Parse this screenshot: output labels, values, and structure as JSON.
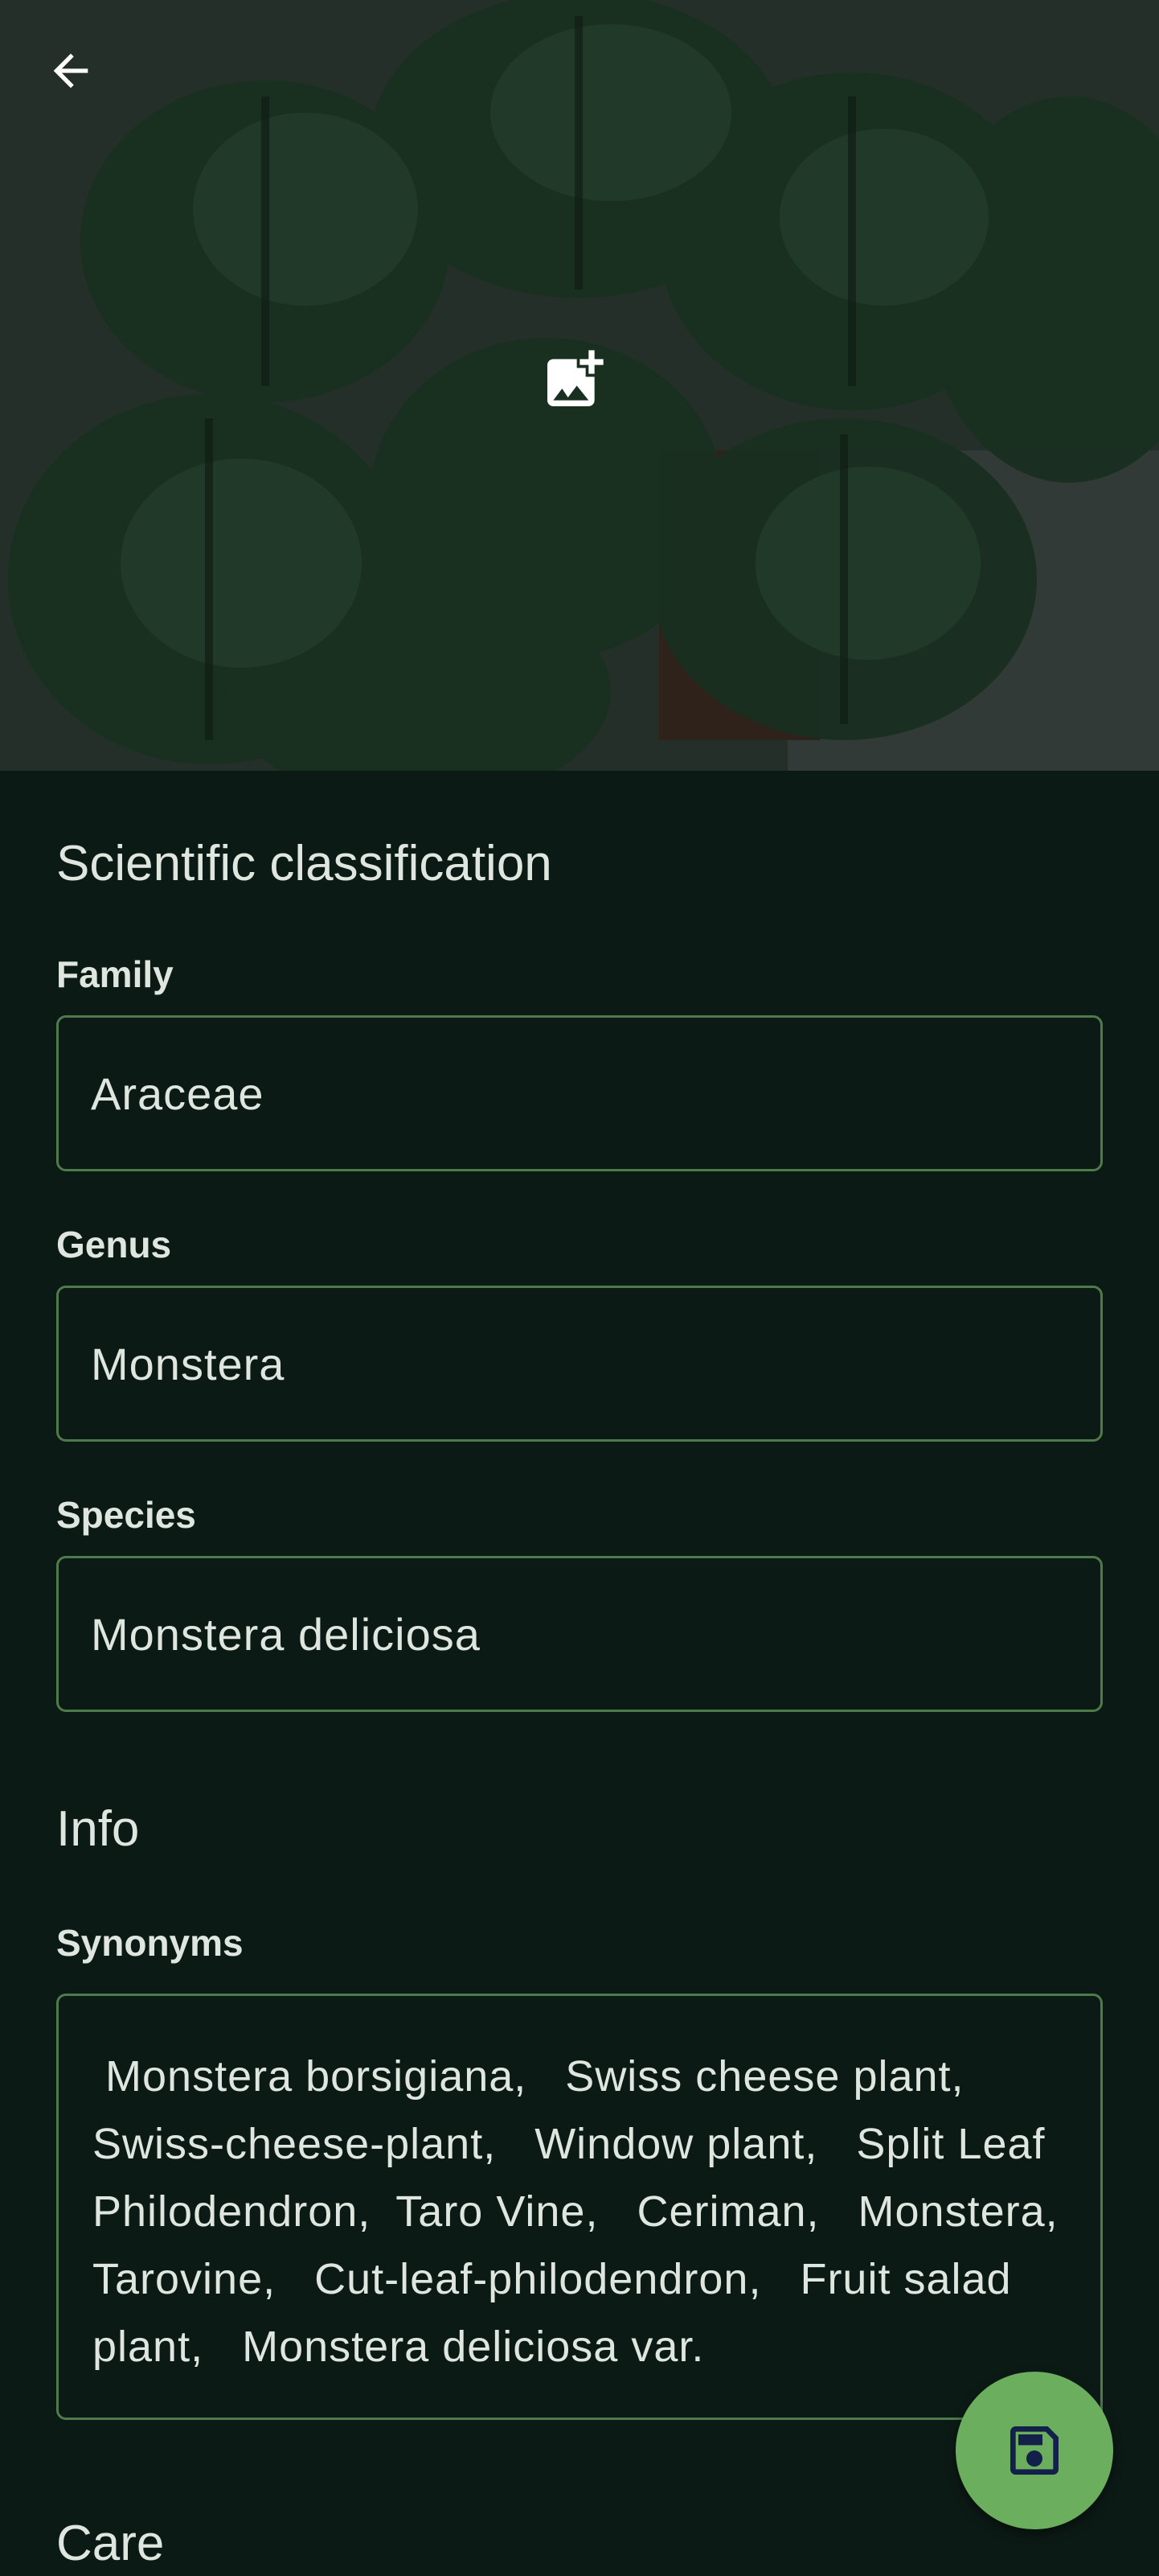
{
  "hero": {
    "back_icon": "arrow-left-icon",
    "add_photo_icon": "add-photo-icon"
  },
  "classification": {
    "title": "Scientific classification",
    "family_label": "Family",
    "family_value": "Araceae",
    "genus_label": "Genus",
    "genus_value": "Monstera",
    "species_label": "Species",
    "species_value": "Monstera deliciosa"
  },
  "info": {
    "title": "Info",
    "synonyms_label": "Synonyms",
    "synonyms_value": " Monstera borsigiana,   Swiss cheese plant,   Swiss-cheese-plant,   Window plant,   Split Leaf Philodendron,  Taro Vine,   Ceriman,   Monstera,   Tarovine,   Cut-leaf-philodendron,   Fruit salad plant,   Monstera deliciosa var."
  },
  "care": {
    "title": "Care"
  },
  "fab": {
    "icon": "save-icon"
  },
  "colors": {
    "background": "#0c1a15",
    "field_border": "#4f7a4c",
    "fab": "#6aae5e",
    "text": "#dfe6df"
  }
}
